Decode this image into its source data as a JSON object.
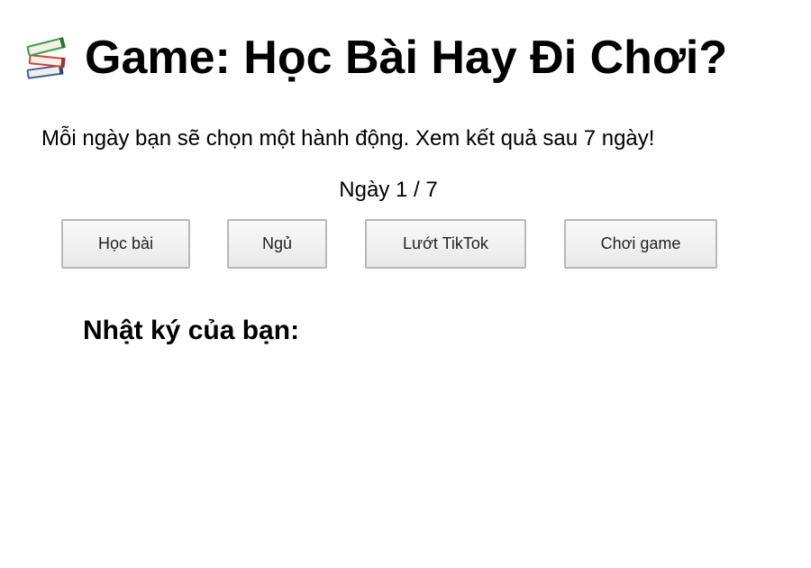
{
  "header": {
    "icon": "books-icon",
    "title": "Game: Học Bài Hay Đi Chơi?"
  },
  "intro": {
    "text": "Mỗi ngày bạn sẽ chọn một hành động. Xem kết quả sau 7 ngày!"
  },
  "day": {
    "label": "Ngày 1 / 7",
    "current": 1,
    "total": 7
  },
  "actions": {
    "study_label": "Học bài",
    "sleep_label": "Ngủ",
    "tiktok_label": "Lướt TikTok",
    "game_label": "Chơi game"
  },
  "diary": {
    "heading": "Nhật ký của bạn:",
    "entries": []
  }
}
